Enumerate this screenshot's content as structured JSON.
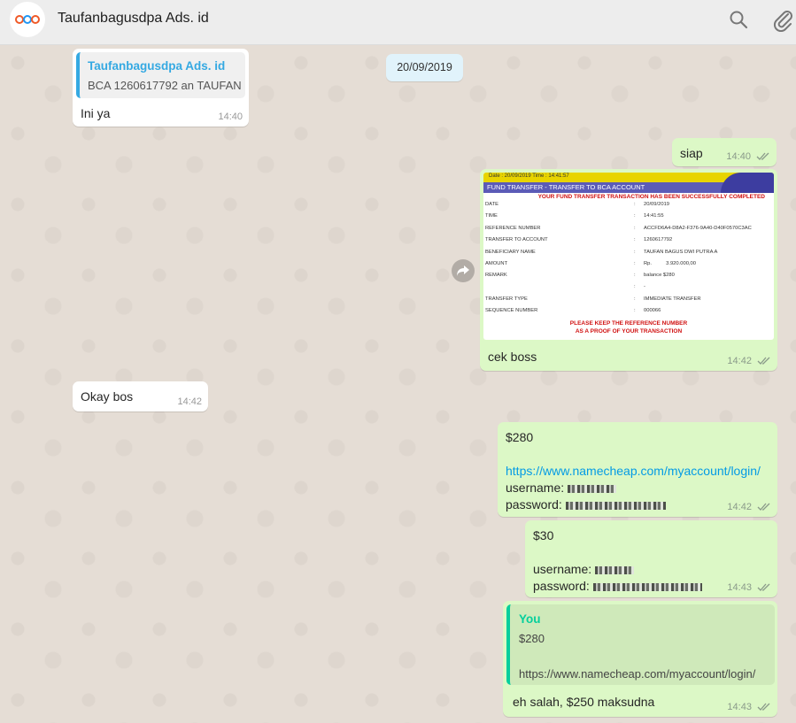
{
  "header": {
    "title": "Taufanbagusdpa Ads. id",
    "avatar_icon": "apa-logo-icon",
    "search_icon": "search-icon",
    "attach_icon": "paperclip-icon"
  },
  "chat": {
    "date_badge": "20/09/2019",
    "messages": [
      {
        "direction": "in",
        "quote": {
          "author": "Taufanbagusdpa Ads. id",
          "text": "BCA 1260617792 an TAUFAN"
        },
        "text": "Ini ya",
        "time": "14:40"
      },
      {
        "direction": "out",
        "text": "siap",
        "time": "14:40"
      },
      {
        "direction": "out",
        "type": "image",
        "caption": "cek boss",
        "time": "14:42",
        "receipt": {
          "top_bar": "Date : 20/09/2019 Time : 14:41:57",
          "title": "FUND TRANSFER - TRANSFER TO BCA ACCOUNT",
          "success": "YOUR FUND TRANSFER TRANSACTION HAS BEEN SUCCESSFULLY COMPLETED",
          "rows": [
            {
              "label": "DATE",
              "value": "20/09/2019"
            },
            {
              "label": "TIME",
              "value": "14:41:55"
            },
            {
              "label": "REFERENCE NUMBER",
              "value": "ACCFD6A4-D8A2-F376-9A40-D40F0570C3AC"
            },
            {
              "label": "TRANSFER TO ACCOUNT",
              "value": "1260617792"
            },
            {
              "label": "BENEFICIARY NAME",
              "value": "TAUFAN BAGUS DWI PUTRA A"
            },
            {
              "label": "AMOUNT",
              "value": "Rp.          3.920.000,00"
            },
            {
              "label": "REMARK",
              "value": "balance $280"
            },
            {
              "label": "",
              "value": "-"
            },
            {
              "label": "TRANSFER TYPE",
              "value": "IMMEDIATE TRANSFER"
            },
            {
              "label": "SEQUENCE NUMBER",
              "value": "000066"
            }
          ],
          "keep_line1": "PLEASE KEEP THE REFERENCE NUMBER",
          "keep_line2": "AS A PROOF OF YOUR TRANSACTION"
        }
      },
      {
        "direction": "in",
        "text": "Okay bos",
        "time": "14:42"
      },
      {
        "direction": "out",
        "line1": "$280",
        "link": "https://www.namecheap.com/myaccount/login/",
        "username_label": "username:",
        "password_label": "password:",
        "time": "14:42"
      },
      {
        "direction": "out",
        "line1": "$30",
        "username_label": "username:",
        "password_label": "password:",
        "time": "14:43"
      },
      {
        "direction": "out",
        "quote": {
          "author": "You",
          "line1": "$280",
          "line2": "https://www.namecheap.com/myaccount/login/"
        },
        "text": "eh salah, $250 maksudna",
        "time": "14:43"
      }
    ]
  },
  "colors": {
    "outgoing_bubble": "#dcf8c6",
    "incoming_bubble": "#ffffff",
    "link": "#039be5",
    "ticks": "#8a9a8a"
  }
}
